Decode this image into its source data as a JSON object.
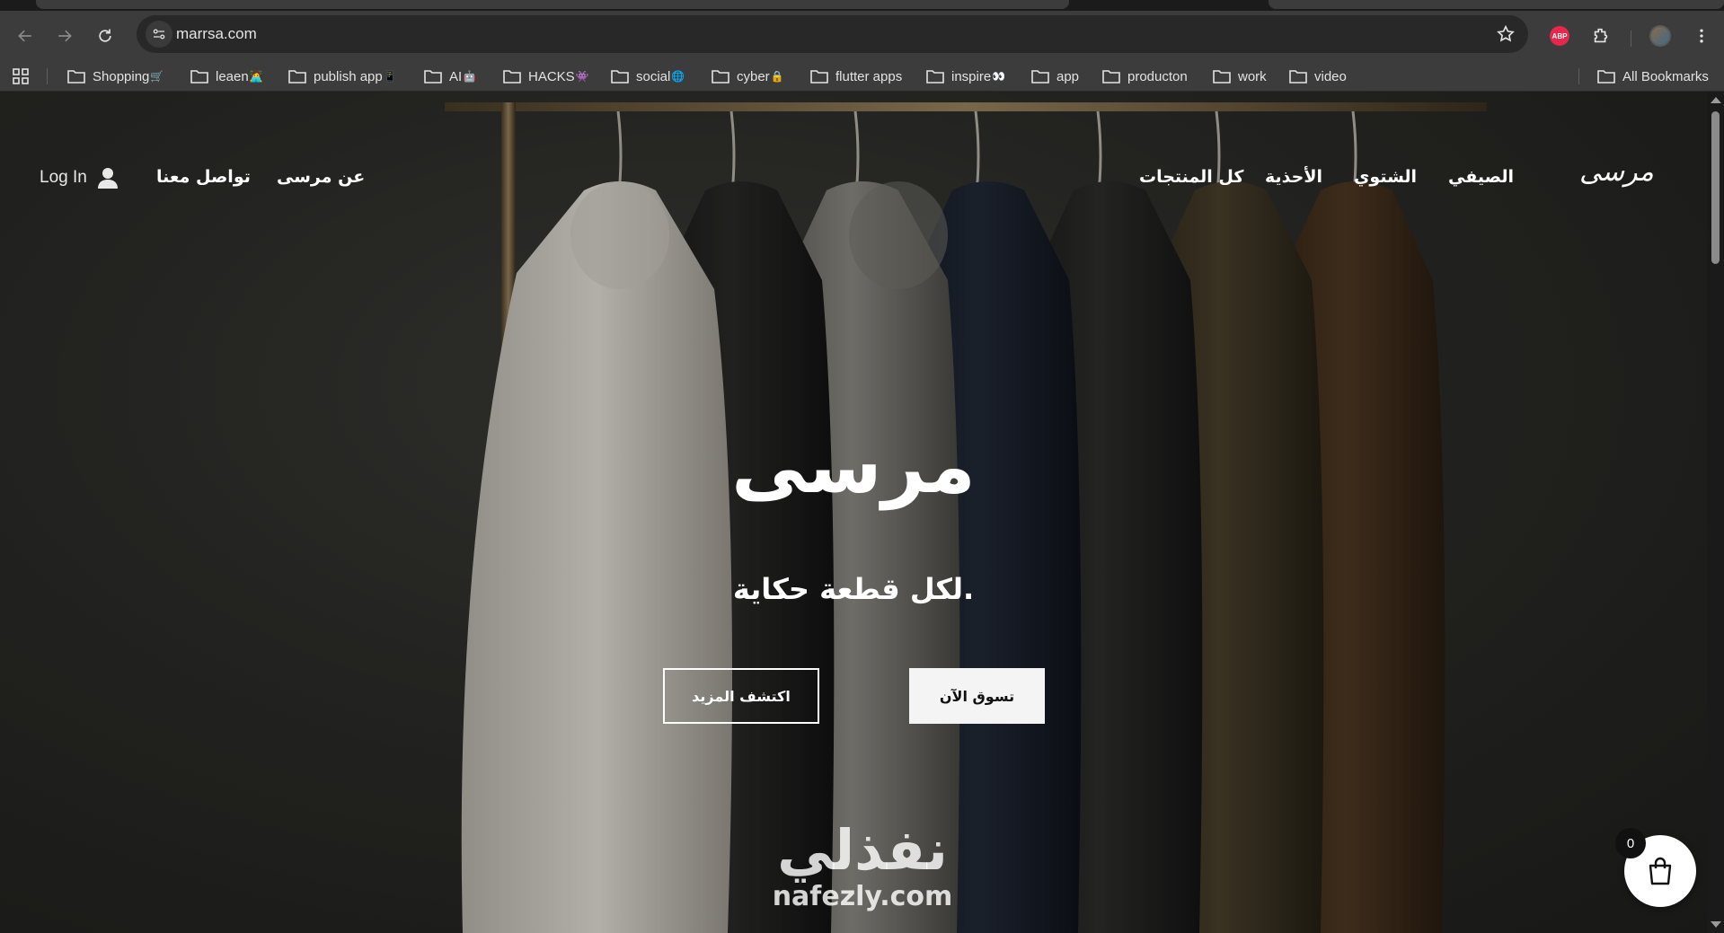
{
  "browser": {
    "url": "marrsa.com",
    "bookmarks": [
      {
        "label": "Shopping",
        "emoji": "🛒"
      },
      {
        "label": "leaen",
        "emoji": "🧑‍💻"
      },
      {
        "label": "publish app",
        "emoji": "📱"
      },
      {
        "label": "AI",
        "emoji": "🤖"
      },
      {
        "label": "HACKS",
        "emoji": "👾"
      },
      {
        "label": "social",
        "emoji": "🌐"
      },
      {
        "label": "cyber",
        "emoji": "🔒"
      },
      {
        "label": "flutter apps",
        "emoji": ""
      },
      {
        "label": "inspire",
        "emoji": "👀"
      },
      {
        "label": "app",
        "emoji": ""
      },
      {
        "label": "producton",
        "emoji": ""
      },
      {
        "label": "work",
        "emoji": ""
      },
      {
        "label": "video",
        "emoji": ""
      }
    ],
    "all_bookmarks_label": "All Bookmarks",
    "icons": [
      "back-icon",
      "forward-icon",
      "reload-icon",
      "site-info-icon",
      "star-icon",
      "abp-icon",
      "extensions-icon",
      "profile-avatar",
      "menu-icon",
      "apps-grid-icon",
      "folder-icon"
    ]
  },
  "site": {
    "logo": "مرسى",
    "nav": {
      "summer": "الصيفي",
      "winter": "الشتوي",
      "shoes": "الأحذية",
      "all_products": "كل المنتجات",
      "about": "عن مرسى",
      "contact": "تواصل معنا",
      "login": "Log In"
    },
    "hero": {
      "title": "مرسى",
      "subtitle": "لكل قطعة حكاية.",
      "shop_now": "تسوق الآن",
      "discover_more": "اكتشف المزيد"
    },
    "watermark": {
      "arabic": "نفذلي",
      "latin": "nafezly.com"
    },
    "cart": {
      "count": "0"
    }
  }
}
